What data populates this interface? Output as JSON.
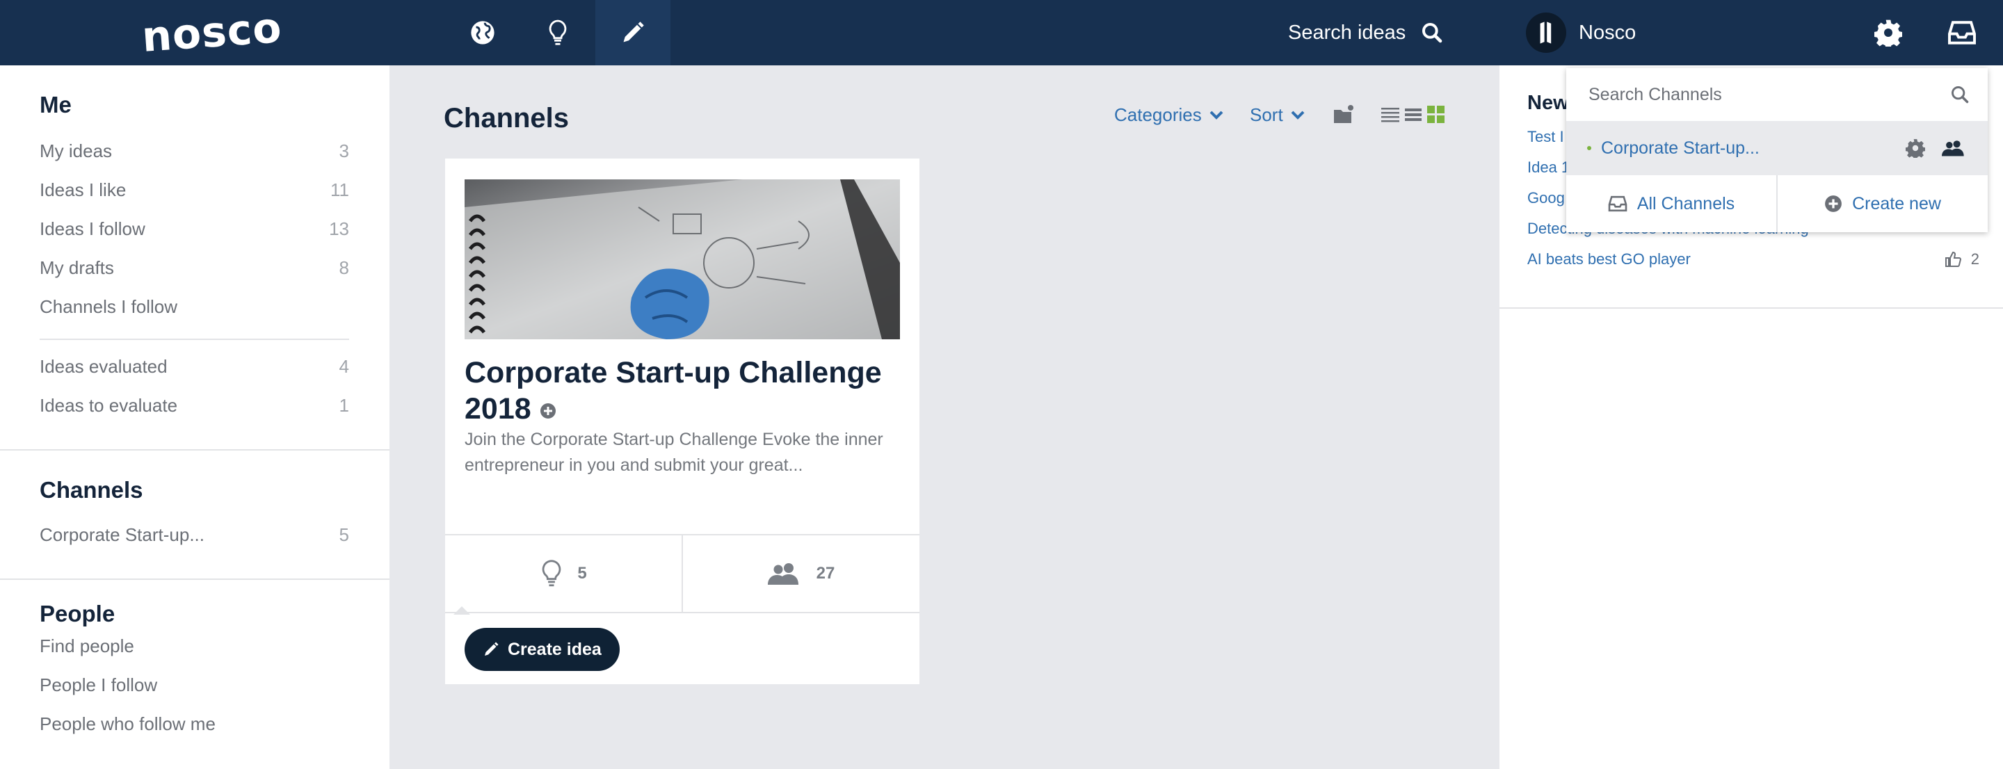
{
  "header": {
    "logo": "nosco",
    "search_label": "Search ideas",
    "user_name": "Nosco",
    "nav_icons": [
      "globe-icon",
      "lightbulb-icon",
      "pencil-icon"
    ],
    "right_icons": [
      "gear-icon",
      "inbox-icon"
    ]
  },
  "sidebar": {
    "me_title": "Me",
    "me_items": [
      {
        "label": "My ideas",
        "count": "3"
      },
      {
        "label": "Ideas I like",
        "count": "11"
      },
      {
        "label": "Ideas I follow",
        "count": "13"
      },
      {
        "label": "My drafts",
        "count": "8"
      },
      {
        "label": "Channels I follow",
        "count": ""
      }
    ],
    "eval_items": [
      {
        "label": "Ideas evaluated",
        "count": "4"
      },
      {
        "label": "Ideas to evaluate",
        "count": "1"
      }
    ],
    "channels_title": "Channels",
    "channel_items": [
      {
        "label": "Corporate Start-up...",
        "count": "5"
      }
    ],
    "people_title": "People",
    "people_items": [
      {
        "label": "Find people"
      },
      {
        "label": "People I follow"
      },
      {
        "label": "People who follow me"
      }
    ]
  },
  "main": {
    "title": "Channels",
    "toolbar": {
      "categories": "Categories",
      "sort": "Sort"
    },
    "card": {
      "title": "Corporate Start-up Challenge 2018",
      "description": "Join the Corporate Start-up Challenge Evoke the inner entrepreneur in you and submit your great...",
      "ideas_count": "5",
      "members_count": "27",
      "create_button": "Create idea"
    }
  },
  "rightbar": {
    "title": "New",
    "news": [
      {
        "label": "Test I",
        "likes": ""
      },
      {
        "label": "Idea 1",
        "likes": ""
      },
      {
        "label": "Goog",
        "likes": ""
      },
      {
        "label": "Detecting diseases with machine learning",
        "likes": ""
      },
      {
        "label": "AI beats best GO player",
        "likes": "2"
      }
    ]
  },
  "channels_dropdown": {
    "search_placeholder": "Search Channels",
    "channel": "Corporate Start-up...",
    "all_channels": "All Channels",
    "create_new": "Create new"
  },
  "colors": {
    "topbar": "#173050",
    "link": "#2f6fb0",
    "accent_green": "#7bb33e",
    "button_dark": "#0f2235"
  }
}
